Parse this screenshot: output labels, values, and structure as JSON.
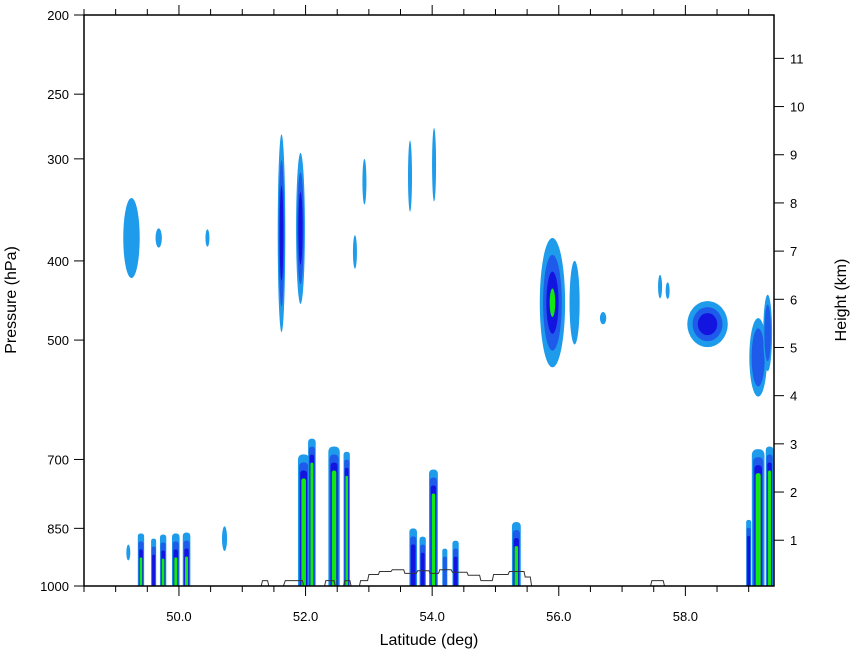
{
  "chart_data": {
    "type": "contour",
    "title": "",
    "xlabel": "Latitude (deg)",
    "ylabel_left": "Pressure (hPa)",
    "ylabel_right": "Height (km)",
    "x_range": [
      48.5,
      59.4
    ],
    "x_ticks": [
      "50.0",
      "52.0",
      "54.0",
      "56.0",
      "58.0"
    ],
    "x_tick_values": [
      50,
      52,
      54,
      56,
      58
    ],
    "y_left_range": [
      1000,
      200
    ],
    "y_left_ticks": [
      "200",
      "250",
      "300",
      "400",
      "500",
      "700",
      "850",
      "1000"
    ],
    "y_left_tick_values": [
      200,
      250,
      300,
      400,
      500,
      700,
      850,
      1000
    ],
    "y_right_range_km": [
      0.05,
      11.9
    ],
    "y_right_ticks": [
      "1",
      "2",
      "3",
      "4",
      "5",
      "6",
      "7",
      "8",
      "9",
      "10",
      "11"
    ],
    "y_right_tick_values": [
      1,
      2,
      3,
      4,
      5,
      6,
      7,
      8,
      9,
      10,
      11
    ],
    "level_colors": [
      "#1E9BEA",
      "#1E5BEA",
      "#1414E0",
      "#12E812",
      "#1E9BEA"
    ],
    "terrain_color": "#333333",
    "blobs": [
      {
        "lat": 49.25,
        "p": 375,
        "w": 0.13,
        "h": 40,
        "levels": 1
      },
      {
        "lat": 49.68,
        "p": 375,
        "w": 0.05,
        "h": 10,
        "levels": 1
      },
      {
        "lat": 50.45,
        "p": 375,
        "w": 0.03,
        "h": 9,
        "levels": 1
      },
      {
        "lat": 51.62,
        "p": 370,
        "w": 0.06,
        "h": 90,
        "levels": 3
      },
      {
        "lat": 51.92,
        "p": 365,
        "w": 0.07,
        "h": 70,
        "levels": 3
      },
      {
        "lat": 52.78,
        "p": 390,
        "w": 0.02,
        "h": 18,
        "levels": 1
      },
      {
        "lat": 52.93,
        "p": 320,
        "w": 0.03,
        "h": 20,
        "levels": 1
      },
      {
        "lat": 53.65,
        "p": 315,
        "w": 0.03,
        "h": 30,
        "levels": 1
      },
      {
        "lat": 54.03,
        "p": 305,
        "w": 0.03,
        "h": 30,
        "levels": 1
      },
      {
        "lat": 55.9,
        "p": 450,
        "w": 0.2,
        "h": 75,
        "levels": 4
      },
      {
        "lat": 56.25,
        "p": 450,
        "w": 0.08,
        "h": 50,
        "levels": 1
      },
      {
        "lat": 56.7,
        "p": 470,
        "w": 0.05,
        "h": 8,
        "levels": 1
      },
      {
        "lat": 57.6,
        "p": 430,
        "w": 0.02,
        "h": 14,
        "levels": 1
      },
      {
        "lat": 57.72,
        "p": 435,
        "w": 0.02,
        "h": 10,
        "levels": 1
      },
      {
        "lat": 58.35,
        "p": 478,
        "w": 0.32,
        "h": 30,
        "levels": 3
      },
      {
        "lat": 59.15,
        "p": 525,
        "w": 0.14,
        "h": 55,
        "levels": 2
      },
      {
        "lat": 59.3,
        "p": 490,
        "w": 0.07,
        "h": 50,
        "levels": 2
      },
      {
        "lat": 50.72,
        "p": 875,
        "w": 0.04,
        "h": 30,
        "levels": 1
      },
      {
        "lat": 49.2,
        "p": 910,
        "w": 0.02,
        "h": 20,
        "levels": 1
      }
    ],
    "columns": [
      {
        "lat": 49.4,
        "top": 862,
        "w": 0.05,
        "levels": 4
      },
      {
        "lat": 49.6,
        "top": 875,
        "w": 0.04,
        "levels": 3
      },
      {
        "lat": 49.75,
        "top": 865,
        "w": 0.05,
        "levels": 4
      },
      {
        "lat": 49.95,
        "top": 862,
        "w": 0.06,
        "levels": 4
      },
      {
        "lat": 50.12,
        "top": 860,
        "w": 0.06,
        "levels": 4
      },
      {
        "lat": 51.97,
        "top": 690,
        "w": 0.09,
        "levels": 4
      },
      {
        "lat": 52.1,
        "top": 660,
        "w": 0.06,
        "levels": 4
      },
      {
        "lat": 52.45,
        "top": 675,
        "w": 0.09,
        "levels": 4
      },
      {
        "lat": 52.65,
        "top": 685,
        "w": 0.05,
        "levels": 4
      },
      {
        "lat": 53.7,
        "top": 850,
        "w": 0.06,
        "levels": 3
      },
      {
        "lat": 53.85,
        "top": 870,
        "w": 0.05,
        "levels": 3
      },
      {
        "lat": 54.02,
        "top": 720,
        "w": 0.07,
        "levels": 4
      },
      {
        "lat": 54.2,
        "top": 900,
        "w": 0.04,
        "levels": 2
      },
      {
        "lat": 54.37,
        "top": 880,
        "w": 0.05,
        "levels": 3
      },
      {
        "lat": 55.33,
        "top": 835,
        "w": 0.07,
        "levels": 4
      },
      {
        "lat": 59.0,
        "top": 830,
        "w": 0.04,
        "levels": 3
      },
      {
        "lat": 59.15,
        "top": 680,
        "w": 0.1,
        "levels": 4
      },
      {
        "lat": 59.33,
        "top": 675,
        "w": 0.06,
        "levels": 4
      }
    ],
    "terrain": [
      [
        51.3,
        1000
      ],
      [
        51.32,
        985
      ],
      [
        51.4,
        985
      ],
      [
        51.42,
        1000
      ],
      [
        51.65,
        1000
      ],
      [
        51.68,
        985
      ],
      [
        51.95,
        985
      ],
      [
        51.97,
        1000
      ],
      [
        52.3,
        1000
      ],
      [
        52.32,
        985
      ],
      [
        52.45,
        985
      ],
      [
        52.47,
        1000
      ],
      [
        52.6,
        1000
      ],
      [
        52.62,
        985
      ],
      [
        52.7,
        985
      ],
      [
        52.72,
        1000
      ],
      [
        52.85,
        1000
      ],
      [
        52.87,
        985
      ],
      [
        52.98,
        985
      ],
      [
        53.0,
        968
      ],
      [
        53.15,
        968
      ],
      [
        53.17,
        960
      ],
      [
        53.35,
        960
      ],
      [
        53.37,
        955
      ],
      [
        53.55,
        955
      ],
      [
        53.57,
        965
      ],
      [
        53.75,
        965
      ],
      [
        53.77,
        958
      ],
      [
        53.95,
        958
      ],
      [
        53.97,
        965
      ],
      [
        54.1,
        965
      ],
      [
        54.12,
        955
      ],
      [
        54.3,
        955
      ],
      [
        54.32,
        962
      ],
      [
        54.55,
        962
      ],
      [
        54.57,
        970
      ],
      [
        54.75,
        970
      ],
      [
        54.77,
        985
      ],
      [
        54.95,
        985
      ],
      [
        54.97,
        968
      ],
      [
        55.2,
        968
      ],
      [
        55.22,
        960
      ],
      [
        55.45,
        960
      ],
      [
        55.47,
        975
      ],
      [
        55.55,
        975
      ],
      [
        55.57,
        1000
      ],
      [
        57.45,
        1000
      ],
      [
        57.47,
        985
      ],
      [
        57.65,
        985
      ],
      [
        57.67,
        1000
      ]
    ]
  }
}
